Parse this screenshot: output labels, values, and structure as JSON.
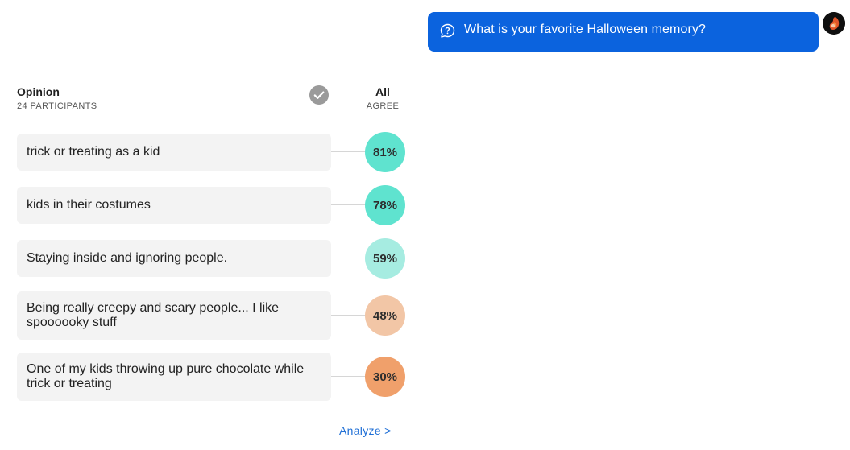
{
  "question": {
    "icon": "question-bubble-icon",
    "text": "What is your favorite Halloween memory?",
    "bubble_color": "#0b63de"
  },
  "avatar": {
    "icon": "user-avatar"
  },
  "header": {
    "title": "Opinion",
    "participants": "24 PARTICIPANTS",
    "check_icon": "check-circle-icon",
    "group_title": "All",
    "group_sub": "AGREE"
  },
  "opinions": [
    {
      "text": "trick or treating as a kid",
      "agree": "81%",
      "color": "#5fe3cf"
    },
    {
      "text": "kids in their costumes",
      "agree": "78%",
      "color": "#5fe3cf"
    },
    {
      "text": "Staying inside and ignoring people.",
      "agree": "59%",
      "color": "#a6ece1"
    },
    {
      "text": "Being really creepy and scary people... I like spoooooky stuff",
      "agree": "48%",
      "color": "#f2c6a6"
    },
    {
      "text": "One of my kids throwing up pure chocolate while trick or treating",
      "agree": "30%",
      "color": "#f0a06b"
    }
  ],
  "footer": {
    "analyze_label": "Analyze >"
  }
}
